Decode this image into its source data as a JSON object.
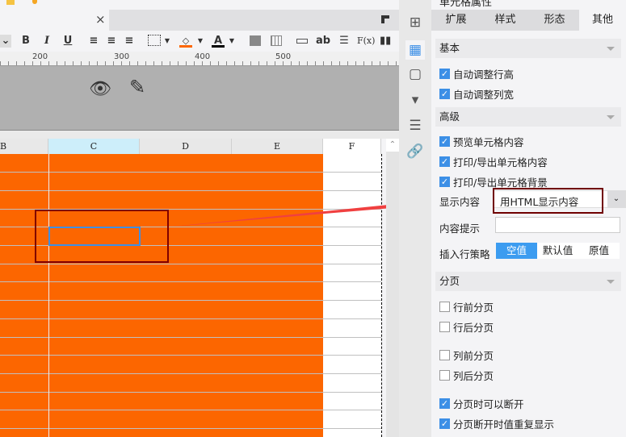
{
  "editor": {
    "tab_close": "×",
    "toolbar": {
      "bold": "B",
      "italic": "I",
      "underline": "U",
      "text": "ab",
      "formula": "F(x)",
      "font_color": "A"
    },
    "ruler": [
      "200",
      "300",
      "400",
      "500"
    ],
    "columns": [
      "B",
      "C",
      "D",
      "E",
      "F"
    ],
    "colors": {
      "cell_fill": "#fc6600",
      "selected_col": "#cdeefa",
      "selection": "#3c8fe6",
      "annotation_box": "#800000",
      "arrow": "#f04040"
    }
  },
  "panel": {
    "title": "单元格属性",
    "tabs": [
      "扩展",
      "样式",
      "形态",
      "其他"
    ],
    "active_tab": "其他",
    "basic": {
      "title": "基本",
      "items": [
        {
          "label": "自动调整行高",
          "checked": true
        },
        {
          "label": "自动调整列宽",
          "checked": true
        }
      ]
    },
    "advanced": {
      "title": "高级",
      "items": [
        {
          "label": "预览单元格内容",
          "checked": true
        },
        {
          "label": "打印/导出单元格内容",
          "checked": true
        },
        {
          "label": "打印/导出单元格背景",
          "checked": true
        }
      ],
      "display_label": "显示内容",
      "display_value": "用HTML显示内容",
      "hint_label": "内容提示",
      "hint_value": "",
      "insert_label": "插入行策略",
      "insert_options": [
        "空值",
        "默认值",
        "原值"
      ],
      "insert_selected": "空值"
    },
    "paging": {
      "title": "分页",
      "items": [
        {
          "label": "行前分页",
          "checked": false
        },
        {
          "label": "行后分页",
          "checked": false
        },
        {
          "label": "列前分页",
          "checked": false
        },
        {
          "label": "列后分页",
          "checked": false
        },
        {
          "label": "分页时可以断开",
          "checked": true
        },
        {
          "label": "分页断开时值重复显示",
          "checked": true
        }
      ]
    }
  }
}
